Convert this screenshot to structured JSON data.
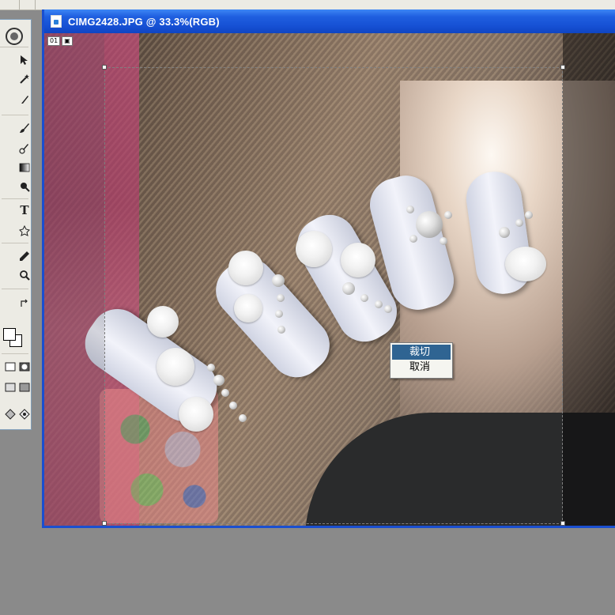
{
  "document": {
    "title": "CIMG2428.JPG @ 33.3%(RGB)",
    "filename": "CIMG2428.JPG",
    "zoom": "33.3%",
    "mode": "RGB",
    "badge": "01"
  },
  "context_menu": {
    "items": [
      {
        "label": "裁切",
        "highlighted": true
      },
      {
        "label": "取消",
        "highlighted": false
      }
    ]
  },
  "toolbox": {
    "tools": [
      "marquee-tool-icon",
      "move-tool-icon",
      "lasso-tool-icon",
      "magic-wand-tool-icon",
      "crop-tool-icon",
      "slice-tool-icon",
      "healing-brush-icon",
      "brush-tool-icon",
      "clone-stamp-icon",
      "history-brush-icon",
      "eraser-tool-icon",
      "gradient-tool-icon",
      "blur-tool-icon",
      "dodge-tool-icon",
      "path-select-icon",
      "type-tool-icon",
      "pen-tool-icon",
      "shape-tool-icon",
      "notes-tool-icon",
      "eyedropper-tool-icon",
      "hand-tool-icon",
      "zoom-tool-icon"
    ],
    "type_glyph": "T"
  },
  "colors": {
    "titlebar_blue": "#1650d4",
    "menu_highlight": "#2f6492",
    "workspace_gray": "#8a8a8a"
  }
}
